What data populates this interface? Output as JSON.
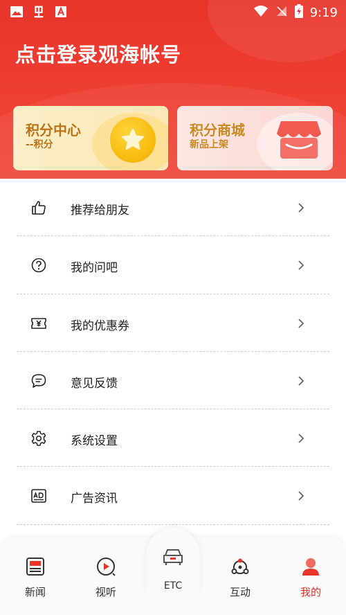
{
  "status_bar": {
    "time": "9:19",
    "left_icons": [
      "image-icon",
      "app-icon",
      "text-icon"
    ],
    "right_icons": [
      "wifi-icon",
      "no-signal-icon",
      "battery-charging-icon"
    ]
  },
  "header": {
    "login_text": "点击登录观海帐号",
    "accent_color": "#e8342b"
  },
  "cards": {
    "points": {
      "title": "积分中心",
      "subtitle": "--积分",
      "icon": "star-icon"
    },
    "mall": {
      "title": "积分商城",
      "subtitle": "新品上架",
      "icon": "shop-icon"
    }
  },
  "menu": {
    "items": [
      {
        "label": "推荐给朋友",
        "icon": "thumbs-up-icon"
      },
      {
        "label": "我的问吧",
        "icon": "question-icon"
      },
      {
        "label": "我的优惠券",
        "icon": "coupon-icon"
      },
      {
        "label": "意见反馈",
        "icon": "chat-bubble-icon"
      },
      {
        "label": "系统设置",
        "icon": "gear-icon"
      },
      {
        "label": "广告资讯",
        "icon": "ad-icon"
      }
    ]
  },
  "bottom_nav": {
    "items": [
      {
        "label": "新闻",
        "icon": "news-icon"
      },
      {
        "label": "视听",
        "icon": "play-icon"
      },
      {
        "label": "ETC",
        "icon": "car-icon"
      },
      {
        "label": "互动",
        "icon": "interaction-icon"
      },
      {
        "label": "我的",
        "icon": "user-icon",
        "active": true
      }
    ],
    "active_color": "#e8342b"
  }
}
